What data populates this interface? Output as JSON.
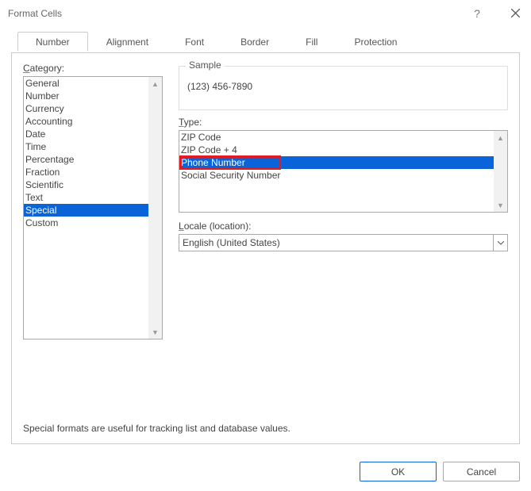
{
  "title": "Format Cells",
  "tabs": [
    {
      "label": "Number"
    },
    {
      "label": "Alignment"
    },
    {
      "label": "Font"
    },
    {
      "label": "Border"
    },
    {
      "label": "Fill"
    },
    {
      "label": "Protection"
    }
  ],
  "category": {
    "label": "Category:",
    "items": [
      "General",
      "Number",
      "Currency",
      "Accounting",
      "Date",
      "Time",
      "Percentage",
      "Fraction",
      "Scientific",
      "Text",
      "Special",
      "Custom"
    ],
    "selected_index": 10
  },
  "sample": {
    "label": "Sample",
    "value": "(123) 456-7890"
  },
  "type": {
    "label": "Type:",
    "items": [
      "ZIP Code",
      "ZIP Code + 4",
      "Phone Number",
      "Social Security Number"
    ],
    "selected_index": 2,
    "highlighted_index": 2
  },
  "locale": {
    "label": "Locale (location):",
    "value": "English (United States)"
  },
  "description": "Special formats are useful for tracking list and database values.",
  "buttons": {
    "ok": "OK",
    "cancel": "Cancel"
  }
}
